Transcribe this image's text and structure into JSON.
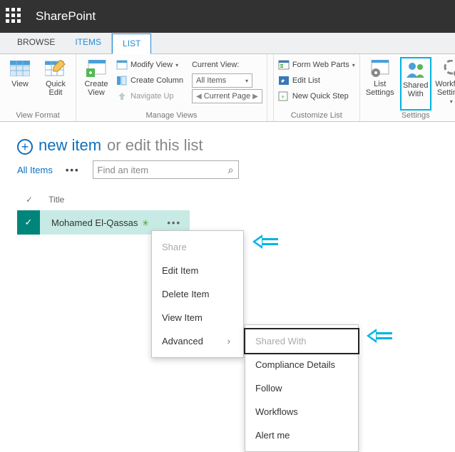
{
  "topbar": {
    "brand": "SharePoint"
  },
  "tabs": {
    "browse": "BROWSE",
    "items": "ITEMS",
    "list": "LIST"
  },
  "ribbon": {
    "view_format": {
      "label": "View Format",
      "view": "View",
      "quick_edit": "Quick\nEdit"
    },
    "manage_views": {
      "label": "Manage Views",
      "create_view": "Create\nView",
      "modify_view": "Modify View",
      "create_column": "Create Column",
      "navigate_up": "Navigate Up",
      "current_view_label": "Current View:",
      "current_view_value": "All Items",
      "current_page": "Current Page"
    },
    "customize": {
      "label": "Customize List",
      "form_web_parts": "Form Web Parts",
      "edit_list": "Edit List",
      "new_quick_step": "New Quick Step"
    },
    "settings": {
      "label": "Settings",
      "list_settings": "List\nSettings",
      "shared_with": "Shared\nWith",
      "workflow_settings": "Workflow\nSettings"
    }
  },
  "content": {
    "new_item": "new item",
    "or_edit": "or edit this list",
    "view_name": "All Items",
    "search_placeholder": "Find an item",
    "col_title": "Title",
    "item_title": "Mohamed El-Qassas"
  },
  "menu": {
    "share": "Share",
    "edit": "Edit Item",
    "delete": "Delete Item",
    "view": "View Item",
    "advanced": "Advanced"
  },
  "submenu": {
    "shared_with": "Shared With",
    "compliance": "Compliance Details",
    "follow": "Follow",
    "workflows": "Workflows",
    "alert": "Alert me"
  }
}
